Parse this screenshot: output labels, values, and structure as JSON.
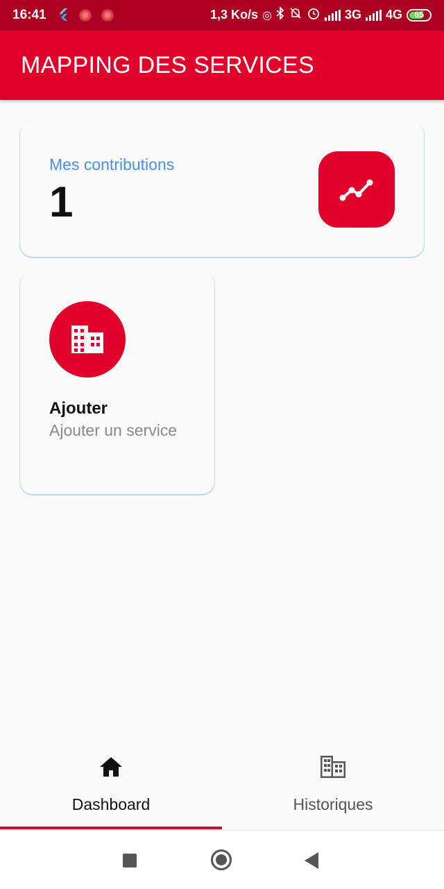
{
  "status_bar": {
    "time": "16:41",
    "speed": "1,3 Ko/s",
    "network_1": "3G",
    "network_2": "4G",
    "battery": "65"
  },
  "app_bar": {
    "title": "MAPPING DES SERVICES",
    "color": "#e1002a"
  },
  "contributions_card": {
    "label": "Mes contributions",
    "value": "1",
    "icon": "trending-up-icon"
  },
  "add_card": {
    "icon": "business-icon",
    "title": "Ajouter",
    "description": "Ajouter un service"
  },
  "bottom_nav": {
    "items": [
      {
        "label": "Dashboard",
        "icon": "home-icon",
        "selected": true
      },
      {
        "label": "Historiques",
        "icon": "business-icon",
        "selected": false
      }
    ],
    "indicator_color": "#c8102e"
  },
  "system_nav": {
    "icons": [
      "recents-icon",
      "home-icon",
      "back-icon"
    ]
  }
}
